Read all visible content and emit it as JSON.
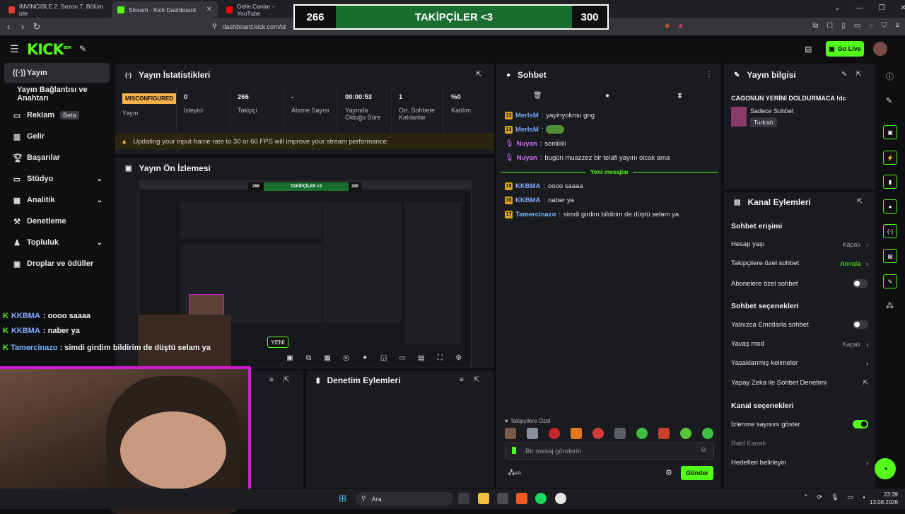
{
  "browser": {
    "tabs": [
      {
        "label": "INVINCIBLE 2. Sezon 7. Bölüm izle",
        "color": "#e23b2f"
      },
      {
        "label": "Stream - Kick Dashboard",
        "color": "#53fc18"
      },
      {
        "label": "Gelin Canlar - YouTube",
        "color": "#ff0000"
      }
    ],
    "url": "dashboard.kick.com/st"
  },
  "banner": {
    "left": "266",
    "center": "TAKİPÇİLER <3",
    "right": "300"
  },
  "header": {
    "logo": "KICK",
    "logo_sup": "BETA",
    "go_live": "Go Live"
  },
  "sidebar": {
    "items": [
      {
        "label": "Yayın",
        "icon": "broadcast-icon"
      },
      {
        "label": "Yayın Bağlantısı ve Anahtarı",
        "icon": ""
      },
      {
        "label": "Reklam",
        "badge": "Beta",
        "icon": "ad-icon"
      },
      {
        "label": "Gelir",
        "icon": "revenue-icon"
      },
      {
        "label": "Başarılar",
        "icon": "trophy-icon"
      },
      {
        "label": "Stüdyo",
        "icon": "studio-icon"
      },
      {
        "label": "Analitik",
        "icon": "analytics-icon"
      },
      {
        "label": "Denetleme",
        "icon": "moderation-icon"
      },
      {
        "label": "Topluluk",
        "icon": "community-icon"
      },
      {
        "label": "Droplar ve ödüller",
        "icon": "drops-icon"
      }
    ]
  },
  "stats": {
    "title": "Yayın İstatistikleri",
    "status_badge": "MISCONFIGURED",
    "status_label": "Yayın",
    "cols": [
      {
        "value": "0",
        "label": "İzleyici"
      },
      {
        "value": "266",
        "label": "Takipçi"
      },
      {
        "value": "-",
        "label": "Abone Sayısı"
      },
      {
        "value": "00:00:53",
        "label": "Yayında Olduğu Süre"
      },
      {
        "value": "1",
        "label": "Ort. Sohbete Katılanlar"
      },
      {
        "value": "%0",
        "label": "Katılım"
      }
    ],
    "warning": "Updating your input frame rate to 30 or 60 FPS will improve your stream performance."
  },
  "preview": {
    "title": "Yayın Ön İzlemesi",
    "new_label": "YENİ",
    "mini_banner": {
      "left": "266",
      "center": "TAKİPÇİLER <3",
      "right": "300"
    }
  },
  "moderation": {
    "title": "Denetim Eylemleri"
  },
  "chat": {
    "title": "Sohbet",
    "messages_before": [
      {
        "badge": "13",
        "user": "MerlsM",
        "text": "yayinyokmu gng",
        "type": "sub"
      },
      {
        "badge": "13",
        "user": "MerlsM",
        "text": "",
        "type": "sub",
        "emote": true
      },
      {
        "badge": "",
        "user": "Nuyan",
        "text": "soriiiiiiii",
        "type": "mic"
      },
      {
        "badge": "",
        "user": "Nuyan",
        "text": "bugün muazzez bir telafi yayını olcak ama",
        "type": "mic"
      }
    ],
    "new_messages_label": "Yeni mesajlar",
    "messages_after": [
      {
        "badge": "16",
        "user": "KKBMA",
        "text": "oooo saaaa"
      },
      {
        "badge": "16",
        "user": "KKBMA",
        "text": "naber ya"
      },
      {
        "badge": "17",
        "user": "Tamercinazo",
        "text": "simdi girdim bildirim de düştü selam ya"
      }
    ],
    "followers_only_label": "Takipçilere Özel",
    "input_placeholder": "Bir mesaj gönderin",
    "send_label": "Gönder"
  },
  "stream_info": {
    "title": "Yayın bilgisi",
    "stream_title": "CAGONUN YERİNİ DOLDURMACA !dc",
    "category": "Sadece Sohbet",
    "language": "Turkish"
  },
  "channel_actions": {
    "title": "Kanal Eylemleri",
    "chat_access_title": "Sohbet erişimi",
    "chat_access": [
      {
        "label": "Hesap yaşı",
        "value": "Kapalı",
        "kind": "chevron"
      },
      {
        "label": "Takipçilere özel sohbet",
        "value": "Anında",
        "kind": "chevron-green"
      },
      {
        "label": "Abonelere özel sohbet",
        "value": "",
        "kind": "toggle-off"
      }
    ],
    "chat_options_title": "Sohbet seçenekleri",
    "chat_options": [
      {
        "label": "Yalnızca Emotlarla sohbet",
        "value": "",
        "kind": "toggle-off"
      },
      {
        "label": "Yavaş mod",
        "value": "Kapalı",
        "kind": "chevron"
      },
      {
        "label": "Yasaklanmış kelimeler",
        "value": "",
        "kind": "chevron"
      },
      {
        "label": "Yapay Zeka ile Sohbet Denetimi",
        "value": "",
        "kind": "external"
      }
    ],
    "channel_options_title": "Kanal seçenekleri",
    "channel_options": [
      {
        "label": "İzlenme sayısını göster",
        "value": "",
        "kind": "toggle-on"
      },
      {
        "label": "Raid Kanalı",
        "value": "",
        "kind": "disabled"
      },
      {
        "label": "Hedefleri belirleyin",
        "value": "",
        "kind": "chevron"
      }
    ]
  },
  "overlay_chat": [
    {
      "user": "KKBMA",
      "text": ": oooo saaaa"
    },
    {
      "user": "KKBMA",
      "text": ": naber ya"
    },
    {
      "user": "Tamercinazo",
      "text": ": simdi girdim bildirim de düştü selam ya"
    }
  ],
  "taskbar": {
    "search": "Ara",
    "time": "23:39",
    "date": "13.08.2026"
  },
  "colors": {
    "accent": "#53fc18",
    "banner_green": "#176e2f",
    "warning": "#f7b24a",
    "webcam_border": "#d11ad0"
  }
}
